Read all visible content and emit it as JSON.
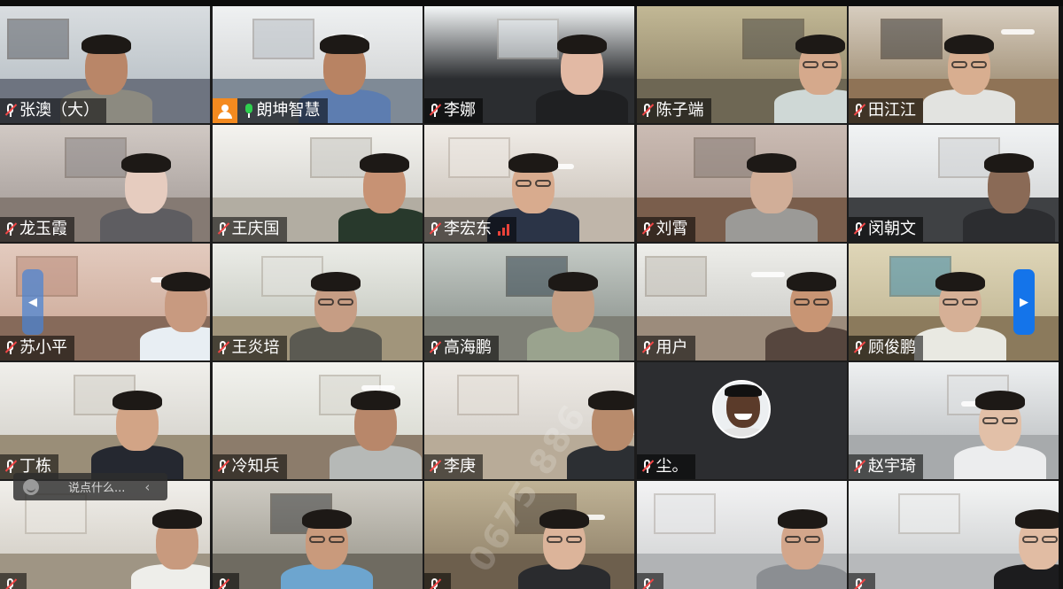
{
  "participants": [
    {
      "name": "张澳（大）",
      "mic": "muted",
      "scene": {
        "wall": "#bfc6cb",
        "floor": "#6e7480",
        "top": "#5b5f66",
        "shirt": "#8c8a80",
        "skin": "#b98668",
        "glasses": false,
        "bright": "#d9dde0"
      }
    },
    {
      "name": "朗坤智慧",
      "mic": "on",
      "host": true,
      "active": true,
      "scene": {
        "wall": "#d7d9da",
        "floor": "#7f8a96",
        "top": "#b8bec4",
        "shirt": "#5d7db0",
        "skin": "#b88363",
        "glasses": false,
        "bright": "#eff1f2"
      }
    },
    {
      "name": "李娜",
      "mic": "muted",
      "scene": {
        "wall": "#2b2d30",
        "floor": "#2b2d30",
        "top": "#e9eef1",
        "shirt": "#1f2022",
        "skin": "#e2b9a4",
        "glasses": false,
        "bright": "#f4f7f8"
      }
    },
    {
      "name": "陈子端",
      "mic": "muted",
      "scene": {
        "wall": "#9a8f72",
        "floor": "#6e6754",
        "top": "#4c4a44",
        "shirt": "#cfd8d6",
        "skin": "#d5a98c",
        "glasses": true,
        "bright": "#c2b895"
      }
    },
    {
      "name": "田江江",
      "mic": "muted",
      "scene": {
        "wall": "#a99981",
        "floor": "#8f7356",
        "top": "#3c3a38",
        "shirt": "#e2e3e0",
        "skin": "#d8ae90",
        "glasses": true,
        "bright": "#d7cdbf"
      }
    },
    {
      "name": "龙玉霞",
      "mic": "muted",
      "scene": {
        "wall": "#b0a8a4",
        "floor": "#857a73",
        "top": "#8a8585",
        "shirt": "#5e5d61",
        "skin": "#e6ccbf",
        "glasses": false,
        "bright": "#d1c9c4"
      }
    },
    {
      "name": "王庆国",
      "mic": "muted",
      "scene": {
        "wall": "#d9d8d3",
        "floor": "#b2ada2",
        "top": "#c7c6c1",
        "shirt": "#28392c",
        "skin": "#c79274",
        "glasses": false,
        "bright": "#f4f3ef"
      }
    },
    {
      "name": "李宏东",
      "mic": "muted",
      "signal": true,
      "scene": {
        "wall": "#d3ccc4",
        "floor": "#c0b6aa",
        "top": "#ebe6e0",
        "shirt": "#2b3447",
        "skin": "#d8ab8e",
        "glasses": true,
        "bright": "#f1ede8"
      }
    },
    {
      "name": "刘霄",
      "mic": "muted",
      "scene": {
        "wall": "#b4a39a",
        "floor": "#7a5e4c",
        "top": "#857a74",
        "shirt": "#9b9a97",
        "skin": "#d1ae98",
        "glasses": false,
        "bright": "#cbbcb4"
      }
    },
    {
      "name": "闵朝文",
      "mic": "muted",
      "scene": {
        "wall": "#d9dbdc",
        "floor": "#3f4144",
        "top": "#cfd1d3",
        "shirt": "#2c2d30",
        "skin": "#8a6a56",
        "glasses": false,
        "bright": "#f1f3f4"
      }
    },
    {
      "name": "苏小平",
      "mic": "muted",
      "scene": {
        "wall": "#d2b2a2",
        "floor": "#866a5a",
        "top": "#ba8b7a",
        "shirt": "#e8eef3",
        "skin": "#c89a80",
        "glasses": false,
        "bright": "#e3cbbf"
      }
    },
    {
      "name": "王炎培",
      "mic": "muted",
      "scene": {
        "wall": "#cdd0c8",
        "floor": "#a1957b",
        "top": "#e0e0db",
        "shirt": "#5b5a52",
        "skin": "#c69d84",
        "glasses": true,
        "bright": "#ecede8"
      }
    },
    {
      "name": "高海鹏",
      "mic": "muted",
      "scene": {
        "wall": "#9aa19c",
        "floor": "#7e7f76",
        "top": "#31414b",
        "shirt": "#9aa38e",
        "skin": "#c59e84",
        "glasses": false,
        "bright": "#c6ccc7"
      }
    },
    {
      "name": "用户",
      "mic": "muted",
      "scene": {
        "wall": "#d3d3cf",
        "floor": "#9c8c7c",
        "top": "#c4c0b8",
        "shirt": "#56463e",
        "skin": "#c89574",
        "glasses": true,
        "bright": "#eeeeea"
      }
    },
    {
      "name": "顾俊鹏",
      "mic": "muted",
      "scene": {
        "wall": "#c7bd9c",
        "floor": "#8b7a5c",
        "top": "#3d8aa8",
        "shirt": "#e9e9e2",
        "skin": "#d6b096",
        "glasses": true,
        "bright": "#dfd6b8"
      }
    },
    {
      "name": "丁栋",
      "mic": "muted",
      "scene": {
        "wall": "#dad8d2",
        "floor": "#9a8e78",
        "top": "#d4d1c9",
        "shirt": "#252830",
        "skin": "#d2a486",
        "glasses": false,
        "bright": "#f0efeb"
      }
    },
    {
      "name": "冷知兵",
      "mic": "muted",
      "scene": {
        "wall": "#ddded6",
        "floor": "#8c7c6b",
        "top": "#d8d7cf",
        "shirt": "#b6b9b7",
        "skin": "#b8876a",
        "glasses": false,
        "bright": "#f2f2ee"
      }
    },
    {
      "name": "李庚",
      "mic": "muted",
      "scene": {
        "wall": "#d9d5cf",
        "floor": "#b8ab98",
        "top": "#e3ded7",
        "shirt": "#2c2f33",
        "skin": "#b88b6c",
        "glasses": false,
        "bright": "#efebe6"
      }
    },
    {
      "name": "尘。",
      "mic": "muted",
      "avatar": true,
      "scene": {
        "wall": "#2c2d30",
        "floor": "#2c2d30",
        "top": "#2c2d30",
        "shirt": "#2c2d30",
        "skin": "#5b3b2a",
        "glasses": false,
        "bright": "#2c2d30"
      }
    },
    {
      "name": "赵宇琦",
      "mic": "muted",
      "scene": {
        "wall": "#c9ccce",
        "floor": "#a7aaac",
        "top": "#dfe1e2",
        "shirt": "#ecedee",
        "skin": "#e2c0a8",
        "glasses": true,
        "bright": "#eef0f1"
      }
    },
    {
      "name": "",
      "mic": "muted",
      "scene": {
        "wall": "#d8d4cc",
        "floor": "#9f9584",
        "top": "#e9e6e0",
        "shirt": "#eeeeea",
        "skin": "#c89a7e",
        "glasses": false,
        "bright": "#f1efeb"
      }
    },
    {
      "name": "",
      "mic": "muted",
      "scene": {
        "wall": "#a8a59b",
        "floor": "#6f6b61",
        "top": "#3a3b3b",
        "shirt": "#6da5cf",
        "skin": "#c99a7c",
        "glasses": true,
        "bright": "#cfccc4"
      }
    },
    {
      "name": "",
      "mic": "muted",
      "scene": {
        "wall": "#9a8c73",
        "floor": "#6d5f4d",
        "top": "#50463a",
        "shirt": "#2a2b2e",
        "skin": "#dcb49a",
        "glasses": true,
        "bright": "#c0b396"
      }
    },
    {
      "name": "",
      "mic": "muted",
      "scene": {
        "wall": "#d9dadb",
        "floor": "#b1b3b5",
        "top": "#e6e7e8",
        "shirt": "#8b8e92",
        "skin": "#d3a68b",
        "glasses": true,
        "bright": "#f3f3f4"
      }
    },
    {
      "name": "",
      "mic": "muted",
      "scene": {
        "wall": "#d4d6d7",
        "floor": "#b7b9bb",
        "top": "#eceded",
        "shirt": "#1c1c1e",
        "skin": "#e1bca3",
        "glasses": true,
        "bright": "#f4f5f5"
      }
    }
  ],
  "chat": {
    "placeholder": "说点什么..."
  },
  "watermark": "0675 886",
  "colors": {
    "active_border": "#2fb84a",
    "muted_slash": "#f04646",
    "host_badge": "#f48a1f",
    "signal": "#e9423a",
    "nav_active": "#1474ea"
  }
}
